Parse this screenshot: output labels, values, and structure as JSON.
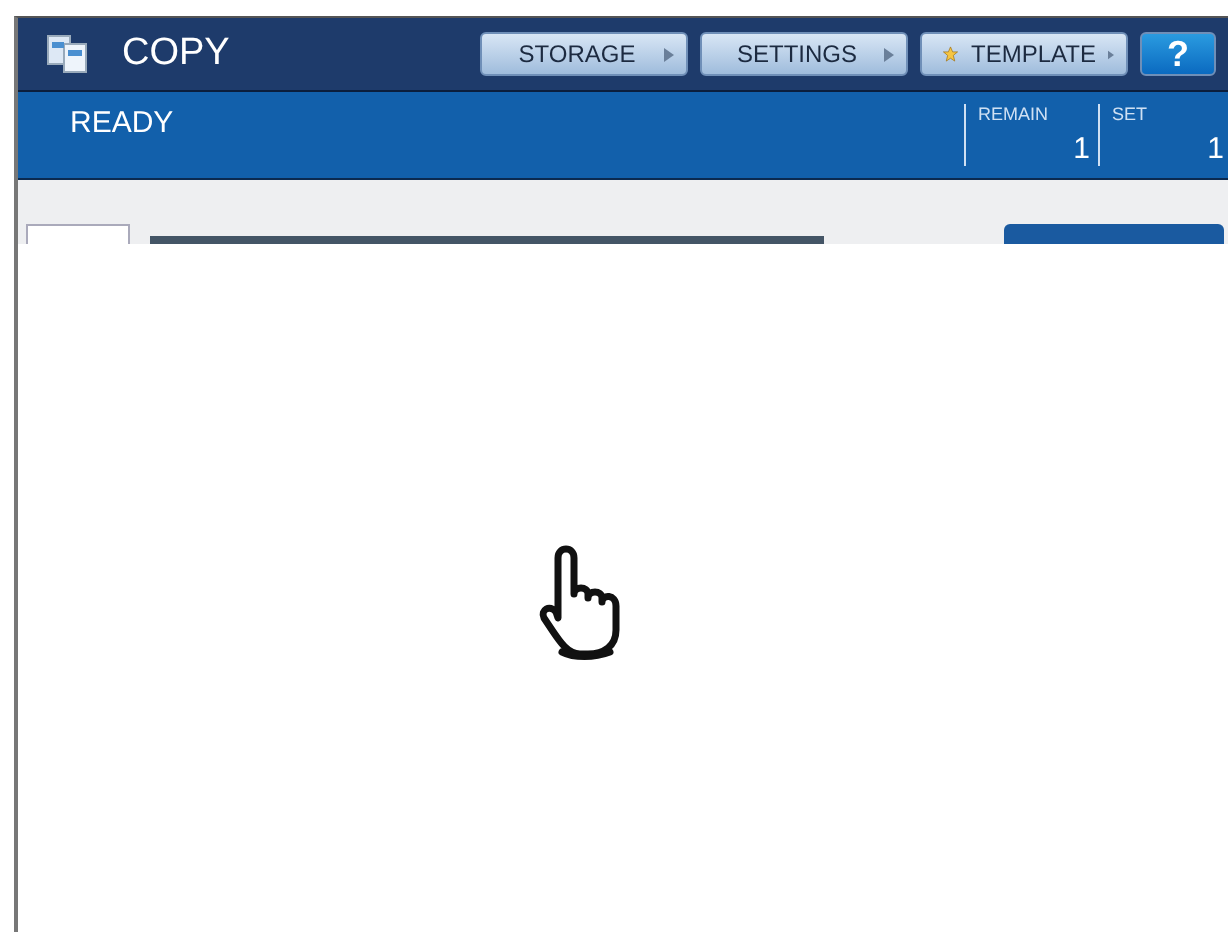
{
  "header": {
    "title": "COPY",
    "buttons": [
      {
        "label": "STORAGE",
        "kind": "menu"
      },
      {
        "label": "SETTINGS",
        "kind": "menu"
      },
      {
        "label": "TEMPLATE",
        "kind": "star"
      },
      {
        "label": "?",
        "kind": "help"
      }
    ]
  },
  "status": {
    "message": "READY",
    "counters": [
      {
        "label": "REMAIN",
        "value": "1"
      },
      {
        "label": "SET",
        "value": "1"
      }
    ]
  }
}
